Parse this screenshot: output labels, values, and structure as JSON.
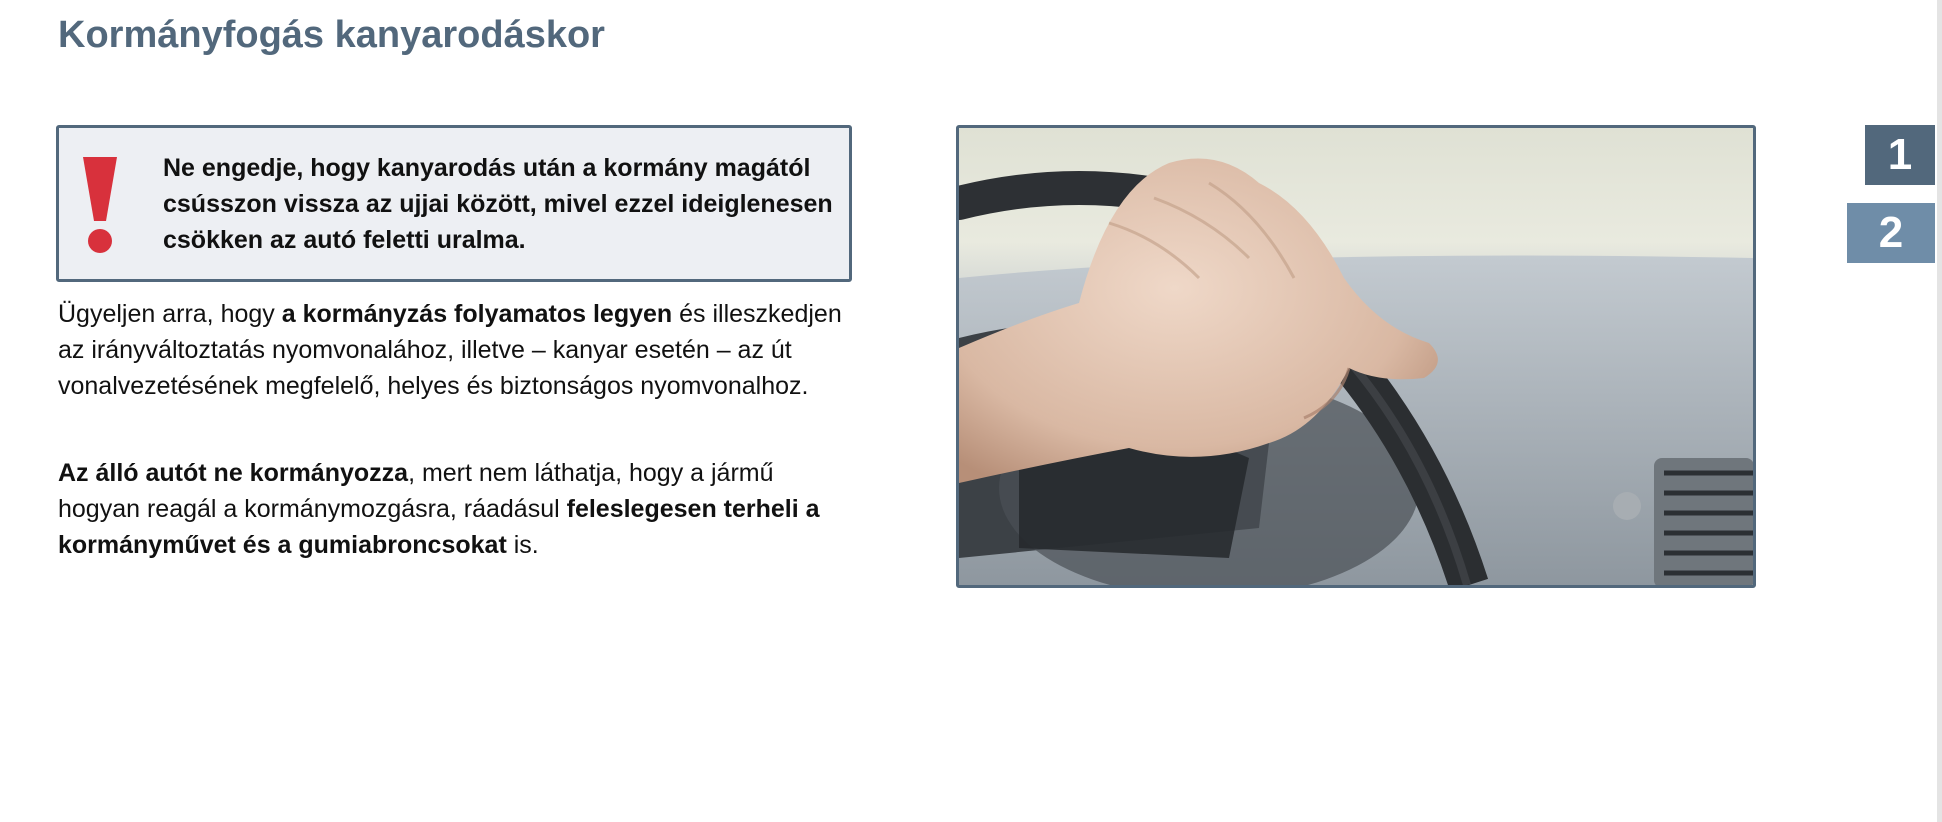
{
  "page": {
    "title": "Kormányfogás kanyarodáskor"
  },
  "warning": {
    "icon": "exclamation-icon",
    "icon_color": "#d8313c",
    "text": "Ne engedje, hogy kanyarodás után a kormány magától csússzon vissza az ujjai között, mivel ezzel ideiglenesen csökken az autó feletti uralma."
  },
  "paragraph1": {
    "t1": "Ügyeljen arra, hogy ",
    "b1": "a kormányzás folyamatos legyen",
    "t2": " és illeszkedjen az irányváltoztatás nyomvonalához, illetve – kanyar esetén – az út vonalvezetésének megfelelő, helyes és biztonságos nyomvonalhoz."
  },
  "paragraph2": {
    "b1": "Az álló autót ne kormányozza",
    "t1": ", mert nem láthatja, hogy a jármű hogyan reagál a kormánymozgásra, ráadásul ",
    "b2": "feleslegesen terheli a kormányművet és a gumiabroncsokat",
    "t2": " is."
  },
  "photo": {
    "subject": "hand-on-steering-wheel"
  },
  "nav": {
    "tabs": [
      {
        "label": "1",
        "active": true
      },
      {
        "label": "2",
        "active": false
      }
    ]
  },
  "colors": {
    "accent": "#52687c",
    "accent_light": "#6f8da8",
    "warning_bg": "#edeff3"
  }
}
